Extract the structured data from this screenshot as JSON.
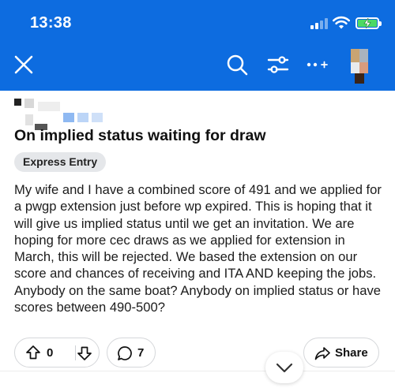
{
  "status_bar": {
    "time": "13:38"
  },
  "toolbar": {
    "close_icon": "close-icon",
    "search_icon": "search-icon",
    "filter_icon": "sliders-icon",
    "more_icon": "more-icon"
  },
  "post": {
    "title": "On implied status waiting for draw",
    "flair": "Express Entry",
    "body": "My wife and I have a combined score of 491 and we applied for a pwgp extension just before wp expired. This is hoping that it will give us implied status until we get an invitation. We are hoping for more cec draws as we applied for extension in March, this will be rejected. We based the extension on our score and chances of receiving and ITA AND keeping the jobs. Anybody on the same boat? Anybody on implied status or have scores between 490-500?"
  },
  "actions": {
    "votes": "0",
    "comments": "7",
    "share_label": "Share"
  },
  "colors": {
    "header_bg": "#0d6ce0",
    "flair_bg": "#e5e7ea",
    "battery_fill": "#4cd964"
  }
}
